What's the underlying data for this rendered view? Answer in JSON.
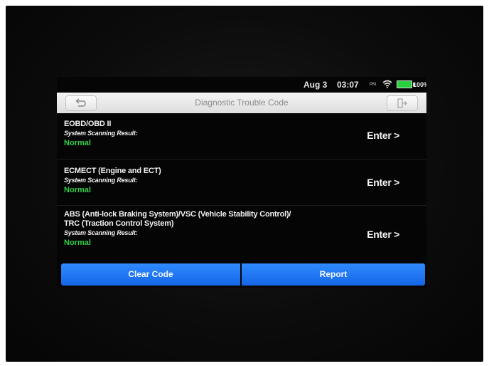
{
  "status_bar": {
    "date": "Aug 3",
    "time": "03:07",
    "ampm": "PM",
    "battery": "100%",
    "battery_color": "#28d040"
  },
  "title_bar": {
    "title": "Diagnostic Trouble Code",
    "back_icon": "back-arrow-icon",
    "exit_icon": "exit-icon"
  },
  "systems": [
    {
      "name": "EOBD/OBD II",
      "sub": "System Scanning Result:",
      "status": "Normal",
      "action": "Enter >"
    },
    {
      "name": "ECMECT (Engine and ECT)",
      "sub": "System Scanning Result:",
      "status": "Normal",
      "action": "Enter >"
    },
    {
      "name_line1": "ABS (Anti-lock Braking System)/VSC (Vehicle Stability Control)/",
      "name_line2": "TRC (Traction Control System)",
      "sub": "System Scanning Result:",
      "status": "Normal",
      "action": "Enter >"
    }
  ],
  "buttons": {
    "clear": "Clear Code",
    "report": "Report",
    "accent_color": "#1e78f5"
  }
}
